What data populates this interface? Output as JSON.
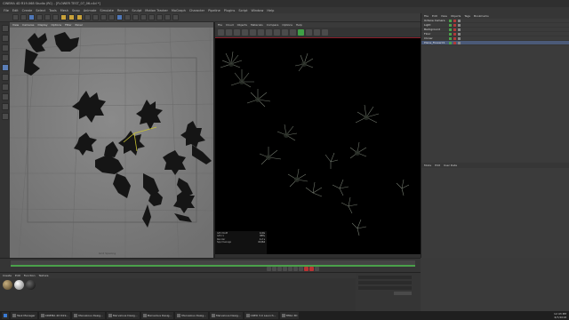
{
  "window": {
    "title": "CINEMA 4D R19.068 Studio (RC) - [FLOWER TEST_07_06.c4d *]"
  },
  "menubar": {
    "items": [
      "File",
      "Edit",
      "Create",
      "Select",
      "Tools",
      "Mesh",
      "Snap",
      "Animate",
      "Simulate",
      "Render",
      "Sculpt",
      "Motion Tracker",
      "MoGraph",
      "Character",
      "Pipeline",
      "Plugins",
      "Script",
      "Window",
      "Help"
    ]
  },
  "viewport": {
    "menu": [
      "View",
      "Cameras",
      "Display",
      "Options",
      "Filter",
      "Panel"
    ]
  },
  "render_viewer": {
    "menu": [
      "File",
      "Cloud",
      "Objects",
      "Materials",
      "Compare",
      "Options",
      "Help"
    ],
    "stats": [
      {
        "label": "GPU RAM",
        "value": "4.6G"
      },
      {
        "label": "GPU 1",
        "value": "88%"
      },
      {
        "label": "Render",
        "value": "1.2 s"
      },
      {
        "label": "Spp/maxspp",
        "value": "64/64"
      }
    ]
  },
  "object_manager": {
    "menu": [
      "File",
      "Edit",
      "View",
      "Objects",
      "Tags",
      "Bookmarks"
    ],
    "objects": [
      {
        "name": "Octane Camera"
      },
      {
        "name": "Light"
      },
      {
        "name": "Background"
      },
      {
        "name": "Floor"
      },
      {
        "name": "Cloner"
      },
      {
        "name": "Plane_Flower01"
      }
    ]
  },
  "attributes": {
    "menu": [
      "Mode",
      "Edit",
      "User Data"
    ]
  },
  "materials": {
    "menu": [
      "Create",
      "Edit",
      "Function",
      "Texture"
    ]
  },
  "taskbar": {
    "items": [
      "Task Manager",
      "CINEMA 4D R19...",
      "Marvelous Desig...",
      "Marvelous Desig...",
      "Marvelous Desig...",
      "Marvelous Desig...",
      "Marvelous Desig...",
      "CREO 3.0 Launch...",
      "TERA 3D"
    ],
    "time": "12:43 PM",
    "date": "6/7/2018"
  }
}
